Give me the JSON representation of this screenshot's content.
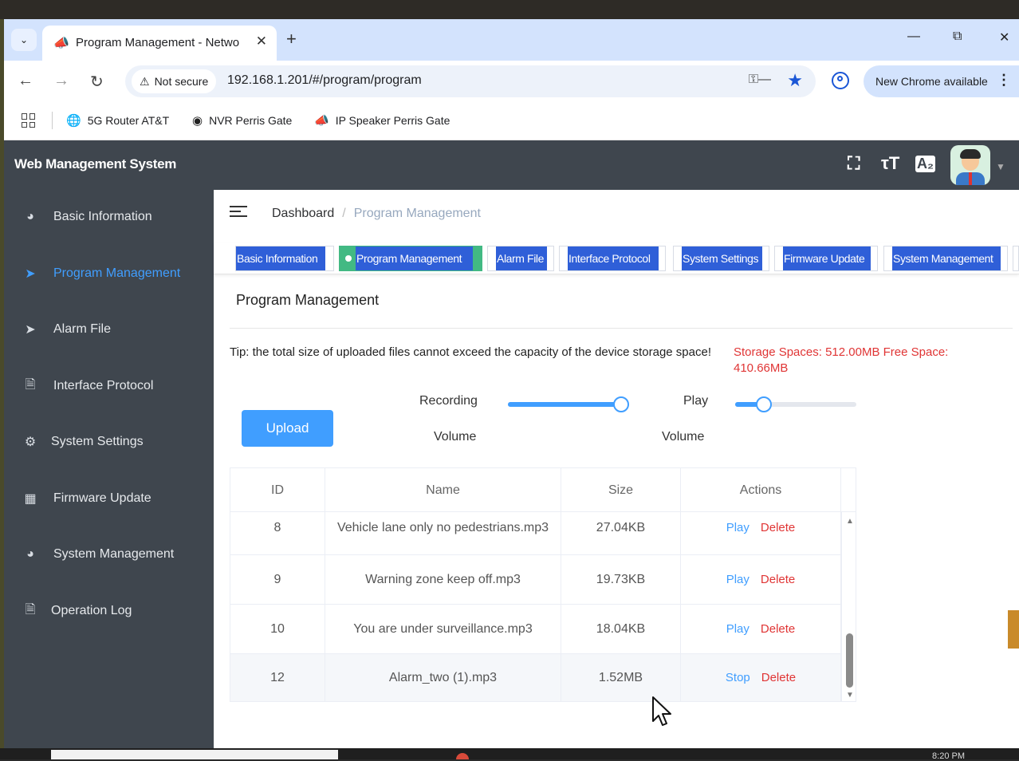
{
  "browser": {
    "tab_title": "Program Management - Netwo",
    "url": "192.168.1.201/#/program/program",
    "security_label": "Not secure",
    "update_label": "New Chrome available",
    "bookmarks": [
      {
        "label": "5G Router AT&T"
      },
      {
        "label": "NVR Perris Gate"
      },
      {
        "label": "IP Speaker Perris Gate"
      }
    ]
  },
  "app": {
    "title": "Web Management System"
  },
  "sidebar": {
    "items": [
      {
        "label": "Basic Information",
        "icon": "dashboard-icon"
      },
      {
        "label": "Program Management",
        "icon": "paper-plane-icon",
        "active": true
      },
      {
        "label": "Alarm File",
        "icon": "paper-plane-icon"
      },
      {
        "label": "Interface Protocol",
        "icon": "document-icon"
      },
      {
        "label": "System Settings",
        "icon": "gear-icon"
      },
      {
        "label": "Firmware Update",
        "icon": "grid-icon"
      },
      {
        "label": "System Management",
        "icon": "globe-icon"
      },
      {
        "label": "Operation Log",
        "icon": "log-icon"
      }
    ]
  },
  "breadcrumb": {
    "root": "Dashboard",
    "current": "Program Management"
  },
  "tags": [
    {
      "label": "Basic Information"
    },
    {
      "label": "Program Management",
      "active": true
    },
    {
      "label": "Alarm File"
    },
    {
      "label": "Interface Protocol"
    },
    {
      "label": "System Settings"
    },
    {
      "label": "Firmware Update"
    },
    {
      "label": "System Management"
    }
  ],
  "content": {
    "title": "Program Management",
    "tip": "Tip: the total size of uploaded files cannot exceed the capacity of the device storage space!",
    "storage": "Storage Spaces: 512.00MB   Free Space: 410.66MB",
    "upload_label": "Upload",
    "recording_label": "Recording",
    "play_label": "Play",
    "volume_label": "Volume",
    "recording_volume": 1.0,
    "play_volume": 0.2
  },
  "table": {
    "headers": [
      "ID",
      "Name",
      "Size",
      "Actions"
    ],
    "rows": [
      {
        "id": "8",
        "name": "Vehicle lane only no pedestrians.mp3",
        "size": "27.04KB",
        "action1": "Play",
        "action2": "Delete"
      },
      {
        "id": "9",
        "name": "Warning zone keep off.mp3",
        "size": "19.73KB",
        "action1": "Play",
        "action2": "Delete"
      },
      {
        "id": "10",
        "name": "You are under surveillance.mp3",
        "size": "18.04KB",
        "action1": "Play",
        "action2": "Delete"
      },
      {
        "id": "12",
        "name": "Alarm_two (1).mp3",
        "size": "1.52MB",
        "action1": "Stop",
        "action2": "Delete"
      }
    ]
  },
  "taskbar": {
    "clock": "8:20 PM"
  },
  "colors": {
    "accent": "#409eff",
    "danger": "#e03535",
    "sidebar_bg": "#3f464e",
    "tag_blue": "#2f5fd8",
    "tag_active_green": "#42b983"
  }
}
